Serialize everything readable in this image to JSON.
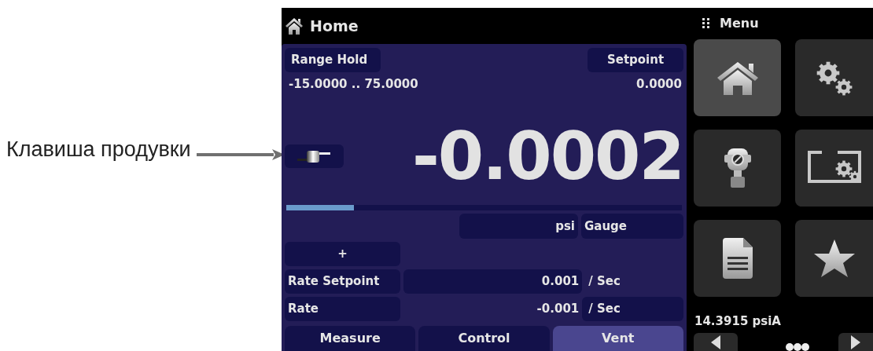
{
  "annotation": {
    "label": "Клавиша продувки"
  },
  "header": {
    "title": "Home"
  },
  "range": {
    "button": "Range Hold",
    "value": "-15.0000 .. 75.0000"
  },
  "setpoint": {
    "button": "Setpoint",
    "value": "0.0000"
  },
  "reading": {
    "value": "-0.0002",
    "level": 0.17
  },
  "units": {
    "unit": "psi",
    "mode": "Gauge"
  },
  "plus_button": "+",
  "rates": [
    {
      "label": "Rate Setpoint",
      "value": "0.001",
      "unit": "/ Sec",
      "kind": "setpoint"
    },
    {
      "label": "Rate",
      "value": "-0.001",
      "unit": "/ Sec",
      "kind": "reading"
    }
  ],
  "tabs": [
    {
      "label": "Measure",
      "selected": false
    },
    {
      "label": "Control",
      "selected": false
    },
    {
      "label": "Vent",
      "selected": true
    }
  ],
  "menu": {
    "title": "Menu",
    "tiles": [
      {
        "kind": "home",
        "selected": true
      },
      {
        "kind": "settings",
        "selected": false
      },
      {
        "kind": "regulator",
        "selected": false
      },
      {
        "kind": "display-settings",
        "selected": false
      },
      {
        "kind": "document",
        "selected": false
      },
      {
        "kind": "star",
        "selected": false
      }
    ]
  },
  "barometer": "14.3915 psiA"
}
